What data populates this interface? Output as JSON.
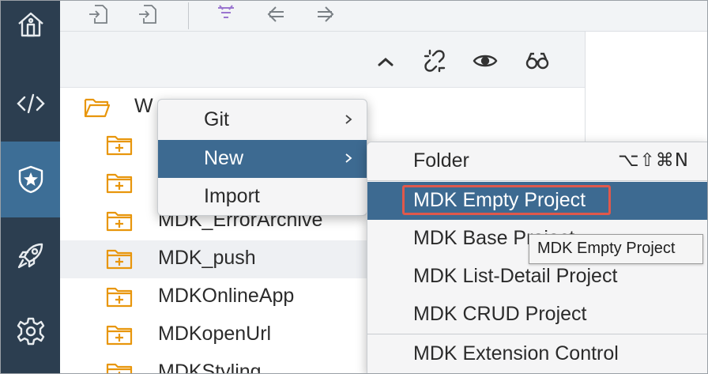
{
  "activity_bar": {
    "items": [
      {
        "icon": "home-icon"
      },
      {
        "icon": "code-icon"
      },
      {
        "icon": "shield-star-icon",
        "active": true
      },
      {
        "icon": "rocket-icon"
      },
      {
        "icon": "gear-icon"
      }
    ]
  },
  "toolbar": {
    "icons": [
      "import-file-icon",
      "export-file-icon",
      "filter-icon",
      "back-arrow-icon",
      "forward-arrow-icon"
    ]
  },
  "panel_header": {
    "icons": [
      "collapse-icon",
      "unlink-icon",
      "eye-icon",
      "binoculars-icon"
    ]
  },
  "tree": {
    "root_label": "W",
    "items": [
      {
        "label": ""
      },
      {
        "label": ""
      },
      {
        "label": "MDK_ErrorArchive"
      },
      {
        "label": "MDK_push",
        "highlighted": true
      },
      {
        "label": "MDKOnlineApp"
      },
      {
        "label": "MDKopenUrl"
      },
      {
        "label": "MDKStyling"
      }
    ]
  },
  "context_menu": {
    "items": [
      {
        "label": "Git",
        "submenu": true
      },
      {
        "label": "New",
        "submenu": true,
        "selected": true
      },
      {
        "label": "Import",
        "submenu": false
      }
    ]
  },
  "submenu": {
    "items": [
      {
        "label": "Folder",
        "shortcut": "⌥⇧⌘N"
      },
      {
        "label": "MDK Empty Project",
        "selected": true
      },
      {
        "label": "MDK Base Project"
      },
      {
        "label": "MDK List-Detail Project"
      },
      {
        "label": "MDK CRUD Project"
      },
      {
        "label": "MDK Extension Control"
      }
    ]
  },
  "tooltip": {
    "text": "MDK Empty Project"
  },
  "colors": {
    "activity_bar_bg": "#2c3e50",
    "activity_active": "#3d6e96",
    "menu_selected": "#3d6a91",
    "focus_outline": "#e0584b",
    "folder_orange": "#e8960c"
  }
}
